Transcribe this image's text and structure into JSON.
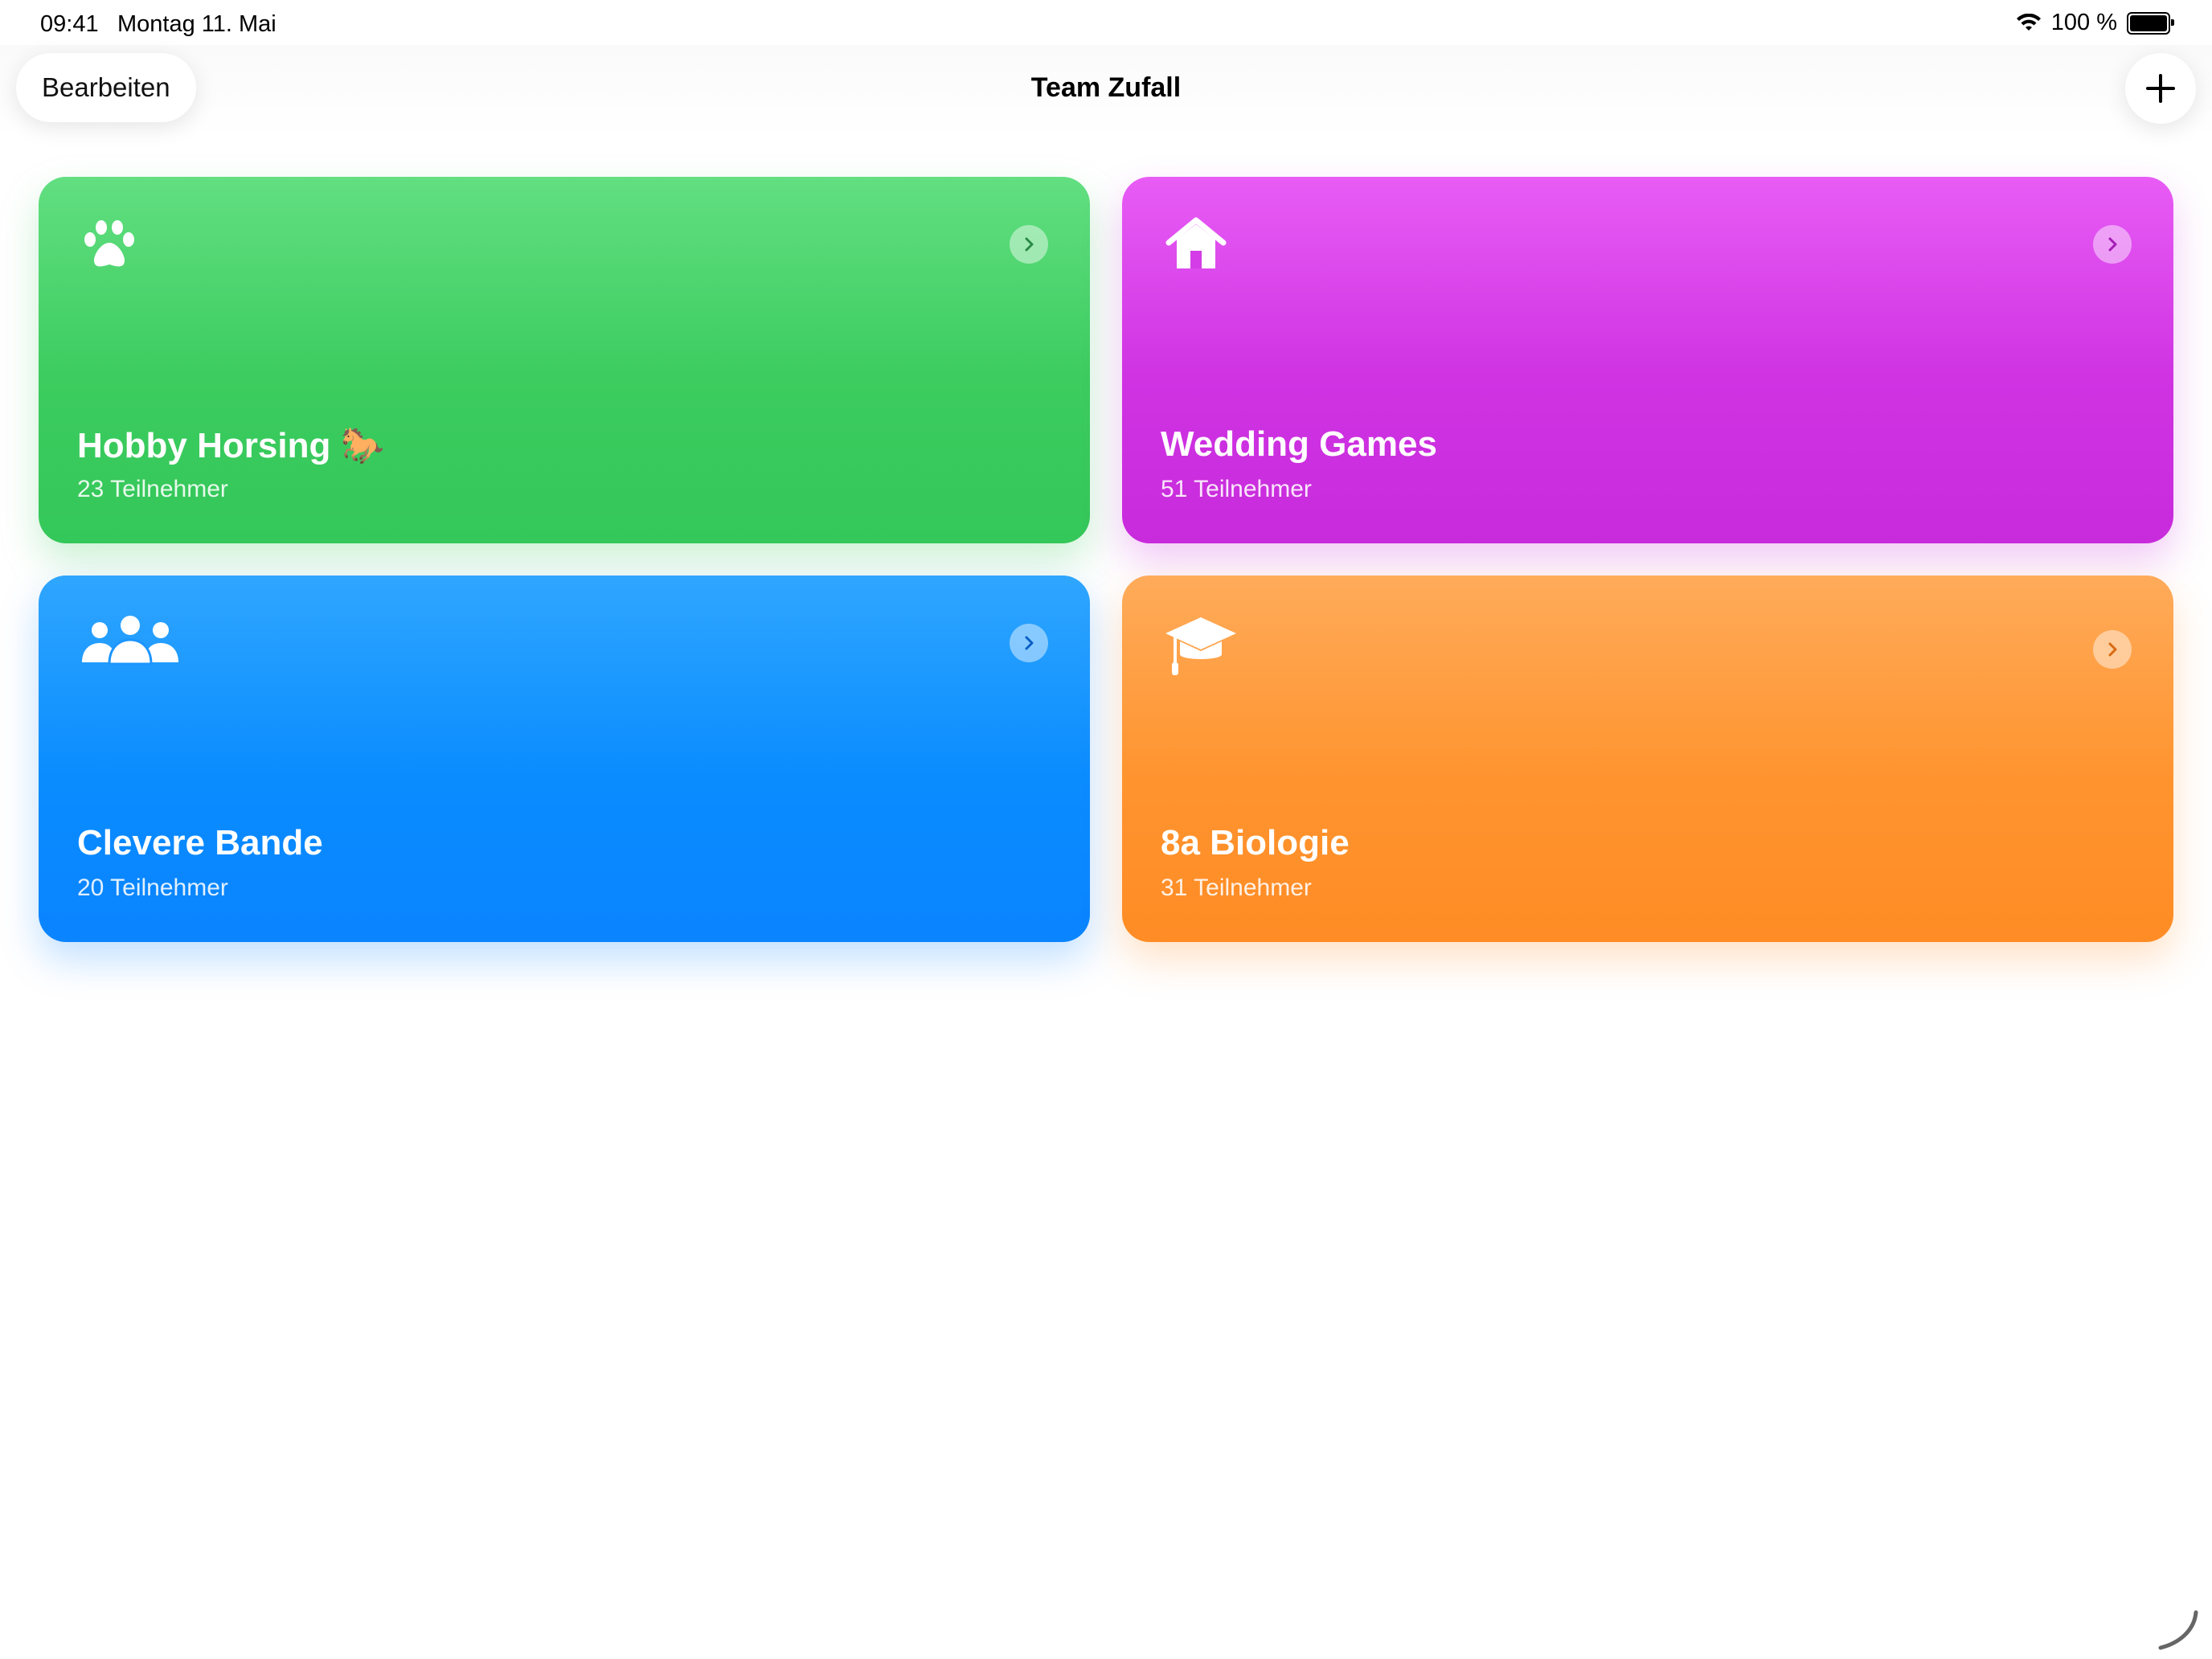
{
  "status_bar": {
    "time": "09:41",
    "date": "Montag 11. Mai",
    "battery_text": "100 %"
  },
  "nav": {
    "edit_label": "Bearbeiten",
    "title": "Team Zufall",
    "add_icon": "plus-icon"
  },
  "cards": [
    {
      "title": "Hobby Horsing 🐎",
      "subtitle": "23 Teilnehmer",
      "icon": "paw-icon",
      "color": "#34c759"
    },
    {
      "title": "Wedding Games",
      "subtitle": "51 Teilnehmer",
      "icon": "house-icon",
      "color": "#c82bdc"
    },
    {
      "title": "Clevere Bande",
      "subtitle": "20 Teilnehmer",
      "icon": "group-icon",
      "color": "#0a84ff"
    },
    {
      "title": "8a Biologie",
      "subtitle": "31 Teilnehmer",
      "icon": "graduation-cap-icon",
      "color": "#ff8c25"
    }
  ]
}
